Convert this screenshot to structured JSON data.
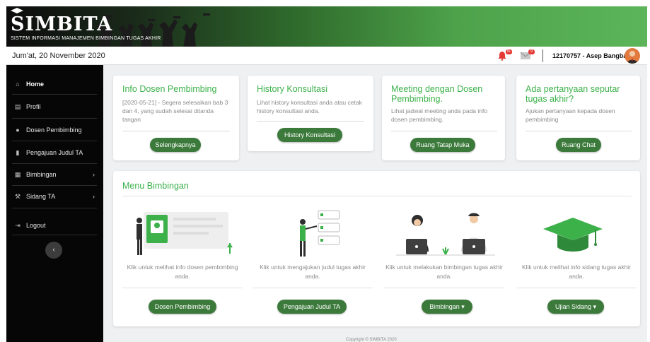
{
  "header": {
    "logo_text": "SIMBITA",
    "tagline": "SISTEM INFORMASI MANAJEMEN BIMBINGAN TUGAS AKHIR"
  },
  "infobar": {
    "date": "Jum'at, 20 November 2020",
    "notification_count": "9+",
    "message_count": "9",
    "username": "12170757 - Asep Bangbang"
  },
  "sidebar": {
    "items": [
      {
        "label": "Home",
        "icon": "home-icon"
      },
      {
        "label": "Profil",
        "icon": "id-card-icon"
      },
      {
        "label": "Dosen Pembimbing",
        "icon": "user-icon"
      },
      {
        "label": "Pengajuan Judul TA",
        "icon": "book-icon"
      },
      {
        "label": "Bimbingan",
        "icon": "calendar-icon"
      },
      {
        "label": "Sidang TA",
        "icon": "gavel-icon"
      },
      {
        "label": "Logout",
        "icon": "logout-icon"
      }
    ],
    "collapse_label": "‹"
  },
  "cards": [
    {
      "title": "Info Dosen Pembimbing",
      "text": "[2020-05-21] - Segera selesaikan bab 3 dan 4, yang sudah selesai ditanda tangan",
      "button": "Selengkapnya"
    },
    {
      "title": "History Konsultasi",
      "text": "Lihat history konsultasi anda atau cetak history konsultasi anda.",
      "button": "History Konsultasi"
    },
    {
      "title": "Meeting dengan Dosen Pembimbing.",
      "text": "Lihat jadwal meeting anda pada info dosen pembimbing.",
      "button": "Ruang Tatap Muka"
    },
    {
      "title": "Ada pertanyaan seputar tugas akhir?",
      "text": "Ajukan pertanyaan kepada dosen pembimbing",
      "button": "Ruang Chat"
    }
  ],
  "menu": {
    "title": "Menu Bimbingan",
    "columns": [
      {
        "text": "Klik untuk melihat info dosen pembimbing anda.",
        "button": "Dosen Pembimbing"
      },
      {
        "text": "Klik untuk mengajukan judul tugas akhir anda.",
        "button": "Pengajuan Judul TA"
      },
      {
        "text": "Klik untuk melakukan bimbingan tugas akhir anda.",
        "button": "Bimbingan ▾"
      },
      {
        "text": "Klik untuk melihat info sidang tugas akhir anda.",
        "button": "Ujian Sidang ▾"
      }
    ]
  },
  "footer": {
    "text": "Copyright © SIMBITA 2020"
  },
  "colors": {
    "accent": "#3cb14a",
    "button": "#3c7a3c",
    "sidebar": "#060606"
  }
}
